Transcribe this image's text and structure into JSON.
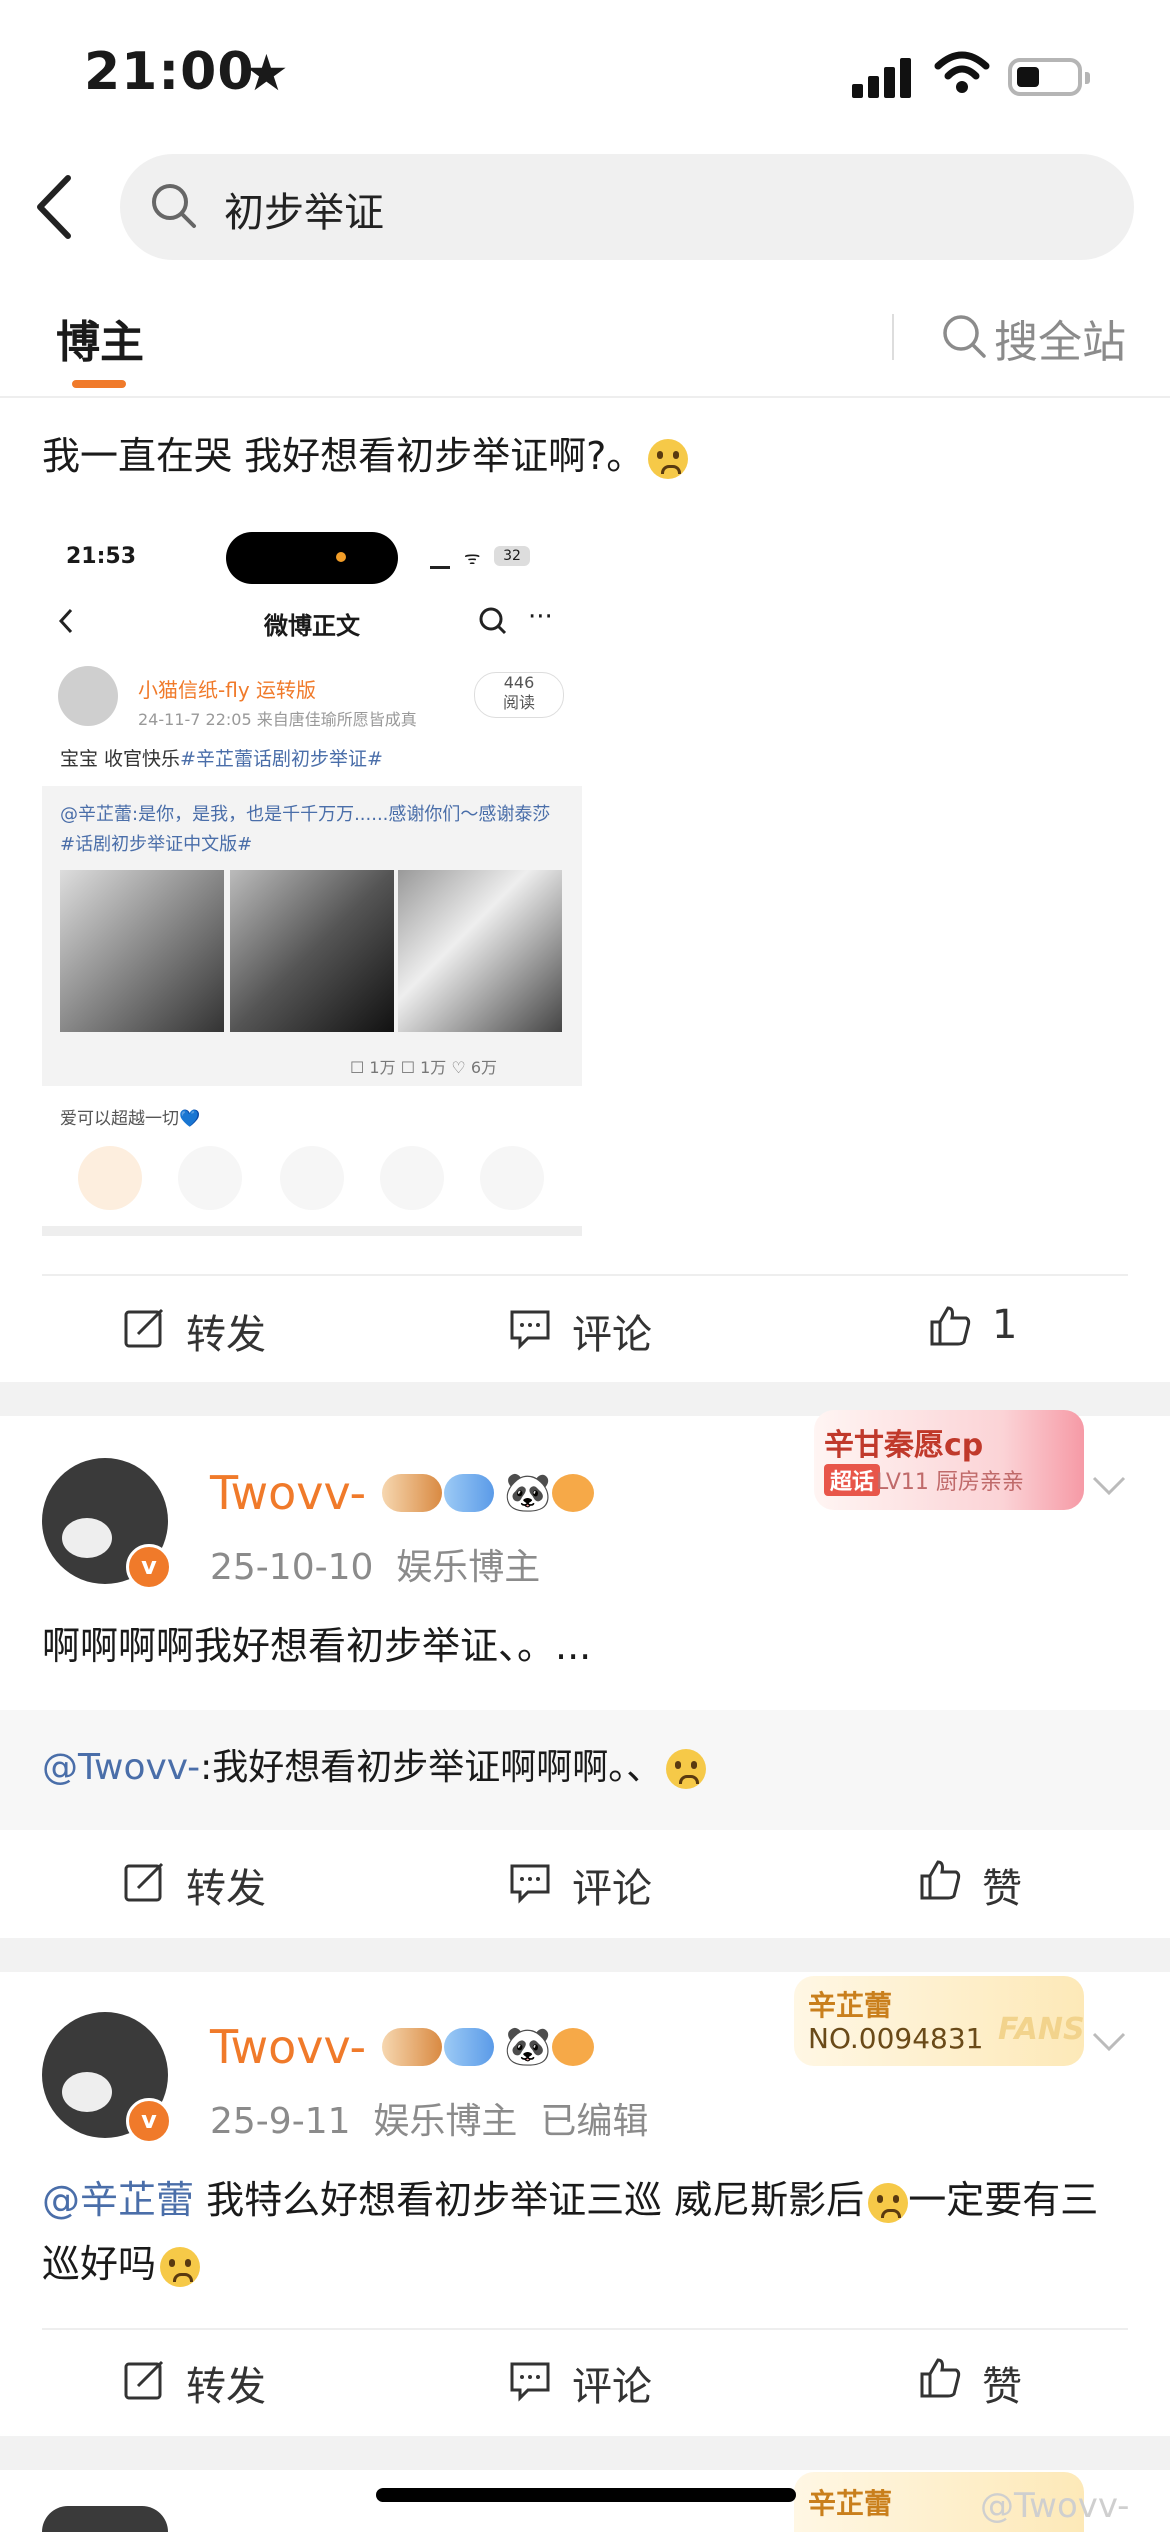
{
  "status": {
    "time": "21:00"
  },
  "search": {
    "query": "初步举证"
  },
  "tabs": {
    "blogger": "博主",
    "site_search": "搜全站"
  },
  "post1": {
    "text": "我一直在哭 我好想看初步举证啊?。",
    "embedded": {
      "time": "21:53",
      "battery": "32",
      "title": "微博正文",
      "author": "小猫信纸-fly 运转版",
      "meta_date": "24-11-7 22:05",
      "meta_source": "来自唐佳瑜所愿皆成真",
      "reads": "446",
      "reads_label": "阅读",
      "text_plain": "宝宝 收官快乐",
      "text_tag": "#辛芷蕾话剧初步举证#",
      "repost": "@辛芷蕾:是你，是我，也是千千万万......感谢你们～感谢泰莎#话剧初步举证中文版#",
      "counts": "☐ 1万   ☐ 1万   ♡ 6万",
      "caption": "爱可以超越一切💙"
    },
    "actions": {
      "repost": "转发",
      "comment": "评论",
      "like_count": "1"
    }
  },
  "post2": {
    "username": "Twovv-",
    "date": "25-10-10",
    "role": "娱乐博主",
    "badge": {
      "title": "辛甘秦愿cp",
      "level_prefix": "超话",
      "level": "LV11 厨房亲亲"
    },
    "text": "啊啊啊啊我好想看初步举证、。...",
    "repost_at": "@Twovv-",
    "repost_text": ":我好想看初步举证啊啊啊。、",
    "actions": {
      "repost": "转发",
      "comment": "评论",
      "like": "赞"
    }
  },
  "post3": {
    "username": "Twovv-",
    "date": "25-9-11",
    "role": "娱乐博主",
    "edited": "已编辑",
    "badge": {
      "name": "辛芷蕾",
      "number": "NO.0094831",
      "fans": "FANS"
    },
    "mention": "@辛芷蕾",
    "text": " 我特么好想看初步举证三巡 威尼斯影后",
    "text2": "一定要有三巡好吗",
    "actions": {
      "repost": "转发",
      "comment": "评论",
      "like": "赞"
    }
  },
  "post4": {
    "badge_name": "辛芷蕾"
  },
  "watermark": "@Twovv-"
}
